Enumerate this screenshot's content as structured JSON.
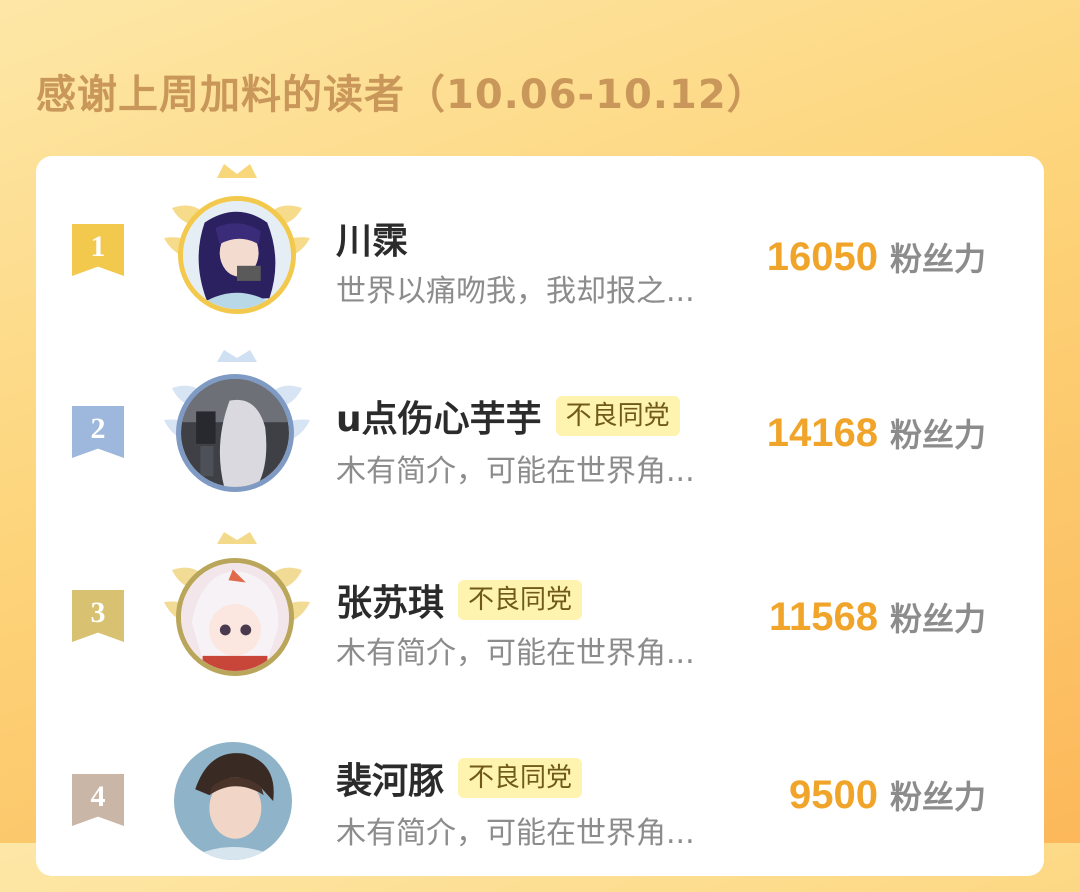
{
  "title": "感谢上周加料的读者（10.06-10.12）",
  "score_unit": "粉丝力",
  "colors": {
    "accent": "#f0a52a",
    "gold": "#f2c94c",
    "silver": "#9db8dc",
    "bronze": "#d8c170",
    "rank4": "#c9b6a6",
    "tag_bg": "#fff3b0"
  },
  "readers": [
    {
      "rank": "1",
      "name": "川霂",
      "tag": "",
      "bio": "世界以痛吻我，我却报之...",
      "score": "16050",
      "badge_color": "#f2c94c",
      "frame": "gold"
    },
    {
      "rank": "2",
      "name": "u点伤心芋芋",
      "tag": "不良同党",
      "bio": "木有简介，可能在世界角...",
      "score": "14168",
      "badge_color": "#9db8dc",
      "frame": "silver"
    },
    {
      "rank": "3",
      "name": "张苏琪",
      "tag": "不良同党",
      "bio": "木有简介，可能在世界角...",
      "score": "11568",
      "badge_color": "#d8c170",
      "frame": "bronze"
    },
    {
      "rank": "4",
      "name": "裴河豚",
      "tag": "不良同党",
      "bio": "木有简介，可能在世界角...",
      "score": "9500",
      "badge_color": "#c9b6a6",
      "frame": "none"
    }
  ]
}
